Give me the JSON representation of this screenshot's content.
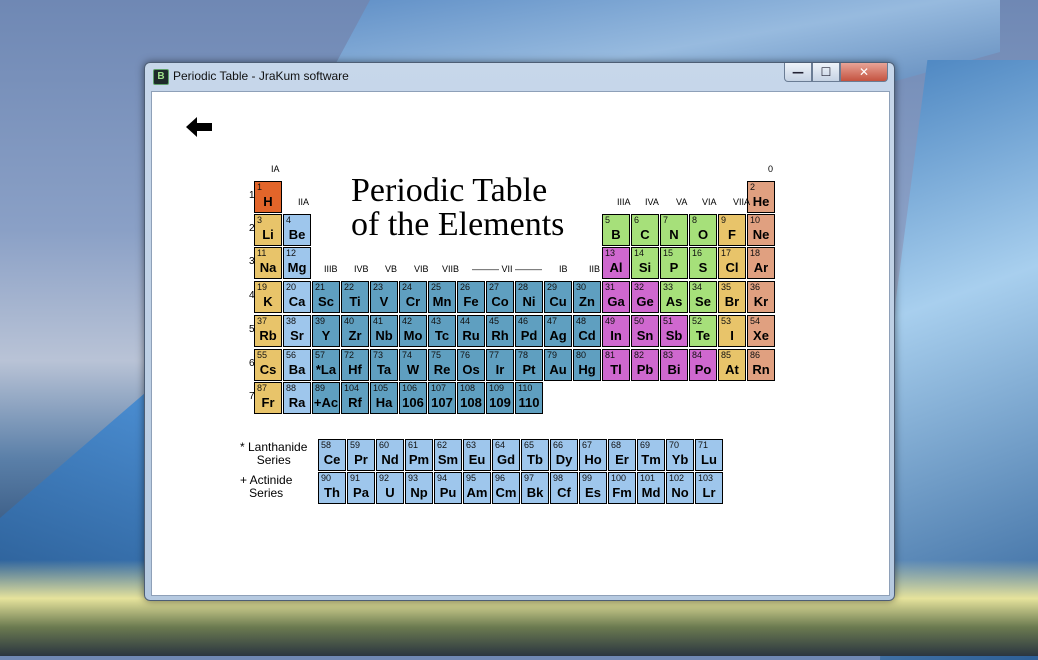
{
  "window": {
    "title": "Periodic Table - JraKum software",
    "icon_glyph": "B",
    "min": "—",
    "max": "☐",
    "close": "✕"
  },
  "heading": {
    "line1": "Periodic Table",
    "line2": "of the Elements"
  },
  "group_labels": [
    "IA",
    "IIA",
    "IIIB",
    "IVB",
    "VB",
    "VIB",
    "VIIB",
    "——— VII ———",
    "IB",
    "IIB",
    "IIIA",
    "IVA",
    "VA",
    "VIA",
    "VIIA",
    "0"
  ],
  "period_numbers": [
    "1",
    "2",
    "3",
    "4",
    "5",
    "6",
    "7"
  ],
  "colors": {
    "alkali": "#e8c46a",
    "hydrogen": "#e2652a",
    "alkaline": "#9ec6ec",
    "transition": "#5f9fc0",
    "lanthanide_actinide": "#9ec6ec",
    "post": "#cf68cf",
    "metalloid": "#a6e07a",
    "nonmetal": "#a6e07a",
    "halogen": "#e8c46a",
    "noble": "#e0a080"
  },
  "elements": [
    {
      "n": "1",
      "s": "H",
      "g": 1,
      "p": 1,
      "c": "hydrogen"
    },
    {
      "n": "2",
      "s": "He",
      "g": 18,
      "p": 1,
      "c": "noble"
    },
    {
      "n": "3",
      "s": "Li",
      "g": 1,
      "p": 2,
      "c": "alkali"
    },
    {
      "n": "4",
      "s": "Be",
      "g": 2,
      "p": 2,
      "c": "alkaline"
    },
    {
      "n": "5",
      "s": "B",
      "g": 13,
      "p": 2,
      "c": "metalloid"
    },
    {
      "n": "6",
      "s": "C",
      "g": 14,
      "p": 2,
      "c": "nonmetal"
    },
    {
      "n": "7",
      "s": "N",
      "g": 15,
      "p": 2,
      "c": "nonmetal"
    },
    {
      "n": "8",
      "s": "O",
      "g": 16,
      "p": 2,
      "c": "nonmetal"
    },
    {
      "n": "9",
      "s": "F",
      "g": 17,
      "p": 2,
      "c": "halogen"
    },
    {
      "n": "10",
      "s": "Ne",
      "g": 18,
      "p": 2,
      "c": "noble"
    },
    {
      "n": "11",
      "s": "Na",
      "g": 1,
      "p": 3,
      "c": "alkali"
    },
    {
      "n": "12",
      "s": "Mg",
      "g": 2,
      "p": 3,
      "c": "alkaline"
    },
    {
      "n": "13",
      "s": "Al",
      "g": 13,
      "p": 3,
      "c": "post"
    },
    {
      "n": "14",
      "s": "Si",
      "g": 14,
      "p": 3,
      "c": "metalloid"
    },
    {
      "n": "15",
      "s": "P",
      "g": 15,
      "p": 3,
      "c": "nonmetal"
    },
    {
      "n": "16",
      "s": "S",
      "g": 16,
      "p": 3,
      "c": "nonmetal"
    },
    {
      "n": "17",
      "s": "Cl",
      "g": 17,
      "p": 3,
      "c": "halogen"
    },
    {
      "n": "18",
      "s": "Ar",
      "g": 18,
      "p": 3,
      "c": "noble"
    },
    {
      "n": "19",
      "s": "K",
      "g": 1,
      "p": 4,
      "c": "alkali"
    },
    {
      "n": "20",
      "s": "Ca",
      "g": 2,
      "p": 4,
      "c": "alkaline"
    },
    {
      "n": "21",
      "s": "Sc",
      "g": 3,
      "p": 4,
      "c": "transition"
    },
    {
      "n": "22",
      "s": "Ti",
      "g": 4,
      "p": 4,
      "c": "transition"
    },
    {
      "n": "23",
      "s": "V",
      "g": 5,
      "p": 4,
      "c": "transition"
    },
    {
      "n": "24",
      "s": "Cr",
      "g": 6,
      "p": 4,
      "c": "transition"
    },
    {
      "n": "25",
      "s": "Mn",
      "g": 7,
      "p": 4,
      "c": "transition"
    },
    {
      "n": "26",
      "s": "Fe",
      "g": 8,
      "p": 4,
      "c": "transition"
    },
    {
      "n": "27",
      "s": "Co",
      "g": 9,
      "p": 4,
      "c": "transition"
    },
    {
      "n": "28",
      "s": "Ni",
      "g": 10,
      "p": 4,
      "c": "transition"
    },
    {
      "n": "29",
      "s": "Cu",
      "g": 11,
      "p": 4,
      "c": "transition"
    },
    {
      "n": "30",
      "s": "Zn",
      "g": 12,
      "p": 4,
      "c": "transition"
    },
    {
      "n": "31",
      "s": "Ga",
      "g": 13,
      "p": 4,
      "c": "post"
    },
    {
      "n": "32",
      "s": "Ge",
      "g": 14,
      "p": 4,
      "c": "post"
    },
    {
      "n": "33",
      "s": "As",
      "g": 15,
      "p": 4,
      "c": "metalloid"
    },
    {
      "n": "34",
      "s": "Se",
      "g": 16,
      "p": 4,
      "c": "nonmetal"
    },
    {
      "n": "35",
      "s": "Br",
      "g": 17,
      "p": 4,
      "c": "halogen"
    },
    {
      "n": "36",
      "s": "Kr",
      "g": 18,
      "p": 4,
      "c": "noble"
    },
    {
      "n": "37",
      "s": "Rb",
      "g": 1,
      "p": 5,
      "c": "alkali"
    },
    {
      "n": "38",
      "s": "Sr",
      "g": 2,
      "p": 5,
      "c": "alkaline"
    },
    {
      "n": "39",
      "s": "Y",
      "g": 3,
      "p": 5,
      "c": "transition"
    },
    {
      "n": "40",
      "s": "Zr",
      "g": 4,
      "p": 5,
      "c": "transition"
    },
    {
      "n": "41",
      "s": "Nb",
      "g": 5,
      "p": 5,
      "c": "transition"
    },
    {
      "n": "42",
      "s": "Mo",
      "g": 6,
      "p": 5,
      "c": "transition"
    },
    {
      "n": "43",
      "s": "Tc",
      "g": 7,
      "p": 5,
      "c": "transition"
    },
    {
      "n": "44",
      "s": "Ru",
      "g": 8,
      "p": 5,
      "c": "transition"
    },
    {
      "n": "45",
      "s": "Rh",
      "g": 9,
      "p": 5,
      "c": "transition"
    },
    {
      "n": "46",
      "s": "Pd",
      "g": 10,
      "p": 5,
      "c": "transition"
    },
    {
      "n": "47",
      "s": "Ag",
      "g": 11,
      "p": 5,
      "c": "transition"
    },
    {
      "n": "48",
      "s": "Cd",
      "g": 12,
      "p": 5,
      "c": "transition"
    },
    {
      "n": "49",
      "s": "In",
      "g": 13,
      "p": 5,
      "c": "post"
    },
    {
      "n": "50",
      "s": "Sn",
      "g": 14,
      "p": 5,
      "c": "post"
    },
    {
      "n": "51",
      "s": "Sb",
      "g": 15,
      "p": 5,
      "c": "post"
    },
    {
      "n": "52",
      "s": "Te",
      "g": 16,
      "p": 5,
      "c": "metalloid"
    },
    {
      "n": "53",
      "s": "I",
      "g": 17,
      "p": 5,
      "c": "halogen"
    },
    {
      "n": "54",
      "s": "Xe",
      "g": 18,
      "p": 5,
      "c": "noble"
    },
    {
      "n": "55",
      "s": "Cs",
      "g": 1,
      "p": 6,
      "c": "alkali"
    },
    {
      "n": "56",
      "s": "Ba",
      "g": 2,
      "p": 6,
      "c": "alkaline"
    },
    {
      "n": "57",
      "s": "*La",
      "g": 3,
      "p": 6,
      "c": "transition"
    },
    {
      "n": "72",
      "s": "Hf",
      "g": 4,
      "p": 6,
      "c": "transition"
    },
    {
      "n": "73",
      "s": "Ta",
      "g": 5,
      "p": 6,
      "c": "transition"
    },
    {
      "n": "74",
      "s": "W",
      "g": 6,
      "p": 6,
      "c": "transition"
    },
    {
      "n": "75",
      "s": "Re",
      "g": 7,
      "p": 6,
      "c": "transition"
    },
    {
      "n": "76",
      "s": "Os",
      "g": 8,
      "p": 6,
      "c": "transition"
    },
    {
      "n": "77",
      "s": "Ir",
      "g": 9,
      "p": 6,
      "c": "transition"
    },
    {
      "n": "78",
      "s": "Pt",
      "g": 10,
      "p": 6,
      "c": "transition"
    },
    {
      "n": "79",
      "s": "Au",
      "g": 11,
      "p": 6,
      "c": "transition"
    },
    {
      "n": "80",
      "s": "Hg",
      "g": 12,
      "p": 6,
      "c": "transition"
    },
    {
      "n": "81",
      "s": "Tl",
      "g": 13,
      "p": 6,
      "c": "post"
    },
    {
      "n": "82",
      "s": "Pb",
      "g": 14,
      "p": 6,
      "c": "post"
    },
    {
      "n": "83",
      "s": "Bi",
      "g": 15,
      "p": 6,
      "c": "post"
    },
    {
      "n": "84",
      "s": "Po",
      "g": 16,
      "p": 6,
      "c": "post"
    },
    {
      "n": "85",
      "s": "At",
      "g": 17,
      "p": 6,
      "c": "halogen"
    },
    {
      "n": "86",
      "s": "Rn",
      "g": 18,
      "p": 6,
      "c": "noble"
    },
    {
      "n": "87",
      "s": "Fr",
      "g": 1,
      "p": 7,
      "c": "alkali"
    },
    {
      "n": "88",
      "s": "Ra",
      "g": 2,
      "p": 7,
      "c": "alkaline"
    },
    {
      "n": "89",
      "s": "+Ac",
      "g": 3,
      "p": 7,
      "c": "transition"
    },
    {
      "n": "104",
      "s": "Rf",
      "g": 4,
      "p": 7,
      "c": "transition"
    },
    {
      "n": "105",
      "s": "Ha",
      "g": 5,
      "p": 7,
      "c": "transition"
    },
    {
      "n": "106",
      "s": "106",
      "g": 6,
      "p": 7,
      "c": "transition"
    },
    {
      "n": "107",
      "s": "107",
      "g": 7,
      "p": 7,
      "c": "transition"
    },
    {
      "n": "108",
      "s": "108",
      "g": 8,
      "p": 7,
      "c": "transition"
    },
    {
      "n": "109",
      "s": "109",
      "g": 9,
      "p": 7,
      "c": "transition"
    },
    {
      "n": "110",
      "s": "110",
      "g": 10,
      "p": 7,
      "c": "transition"
    }
  ],
  "lanthanides": {
    "label1": "* Lanthanide",
    "label2": "Series",
    "items": [
      {
        "n": "58",
        "s": "Ce"
      },
      {
        "n": "59",
        "s": "Pr"
      },
      {
        "n": "60",
        "s": "Nd"
      },
      {
        "n": "61",
        "s": "Pm"
      },
      {
        "n": "62",
        "s": "Sm"
      },
      {
        "n": "63",
        "s": "Eu"
      },
      {
        "n": "64",
        "s": "Gd"
      },
      {
        "n": "65",
        "s": "Tb"
      },
      {
        "n": "66",
        "s": "Dy"
      },
      {
        "n": "67",
        "s": "Ho"
      },
      {
        "n": "68",
        "s": "Er"
      },
      {
        "n": "69",
        "s": "Tm"
      },
      {
        "n": "70",
        "s": "Yb"
      },
      {
        "n": "71",
        "s": "Lu"
      }
    ]
  },
  "actinides": {
    "label1": "+ Actinide",
    "label2": "Series",
    "items": [
      {
        "n": "90",
        "s": "Th"
      },
      {
        "n": "91",
        "s": "Pa"
      },
      {
        "n": "92",
        "s": "U"
      },
      {
        "n": "93",
        "s": "Np"
      },
      {
        "n": "94",
        "s": "Pu"
      },
      {
        "n": "95",
        "s": "Am"
      },
      {
        "n": "96",
        "s": "Cm"
      },
      {
        "n": "97",
        "s": "Bk"
      },
      {
        "n": "98",
        "s": "Cf"
      },
      {
        "n": "99",
        "s": "Es"
      },
      {
        "n": "100",
        "s": "Fm"
      },
      {
        "n": "101",
        "s": "Md"
      },
      {
        "n": "102",
        "s": "No"
      },
      {
        "n": "103",
        "s": "Lr"
      }
    ]
  }
}
